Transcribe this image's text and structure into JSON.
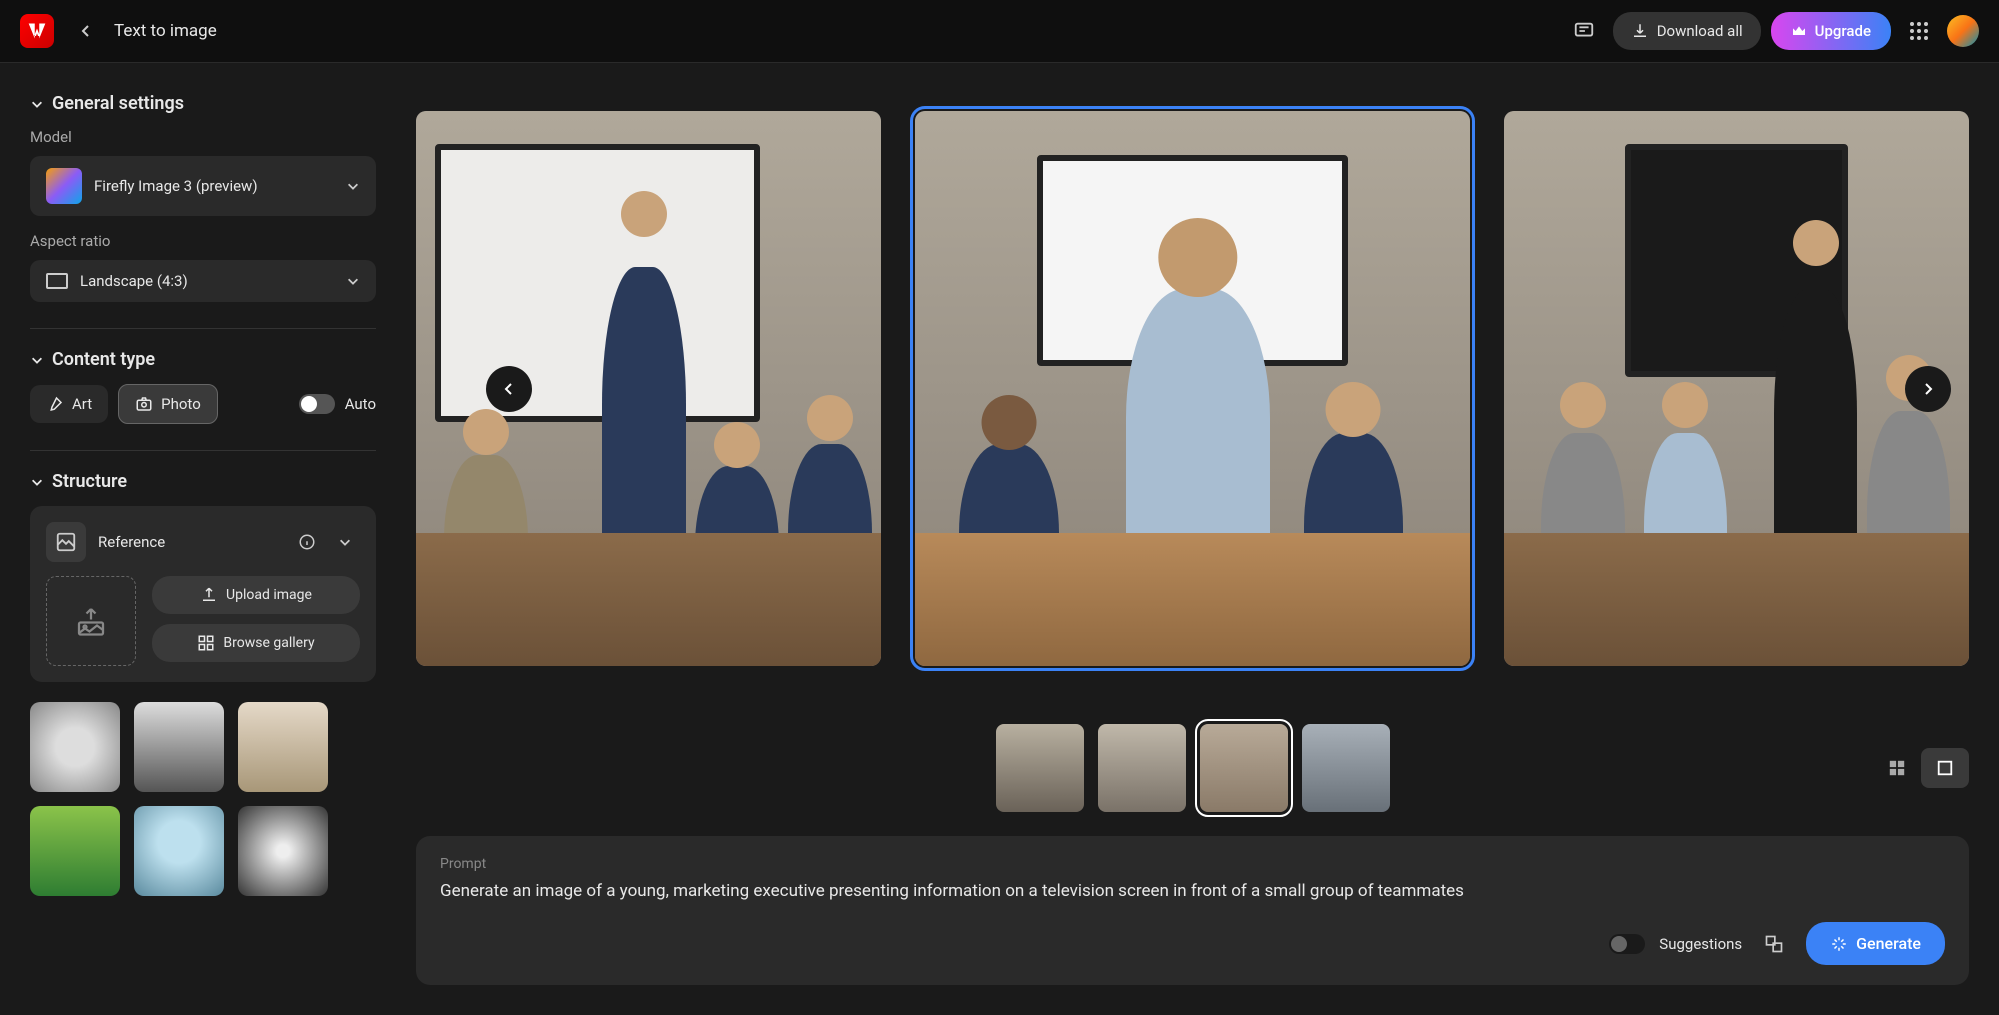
{
  "header": {
    "title": "Text to image",
    "download_label": "Download all",
    "upgrade_label": "Upgrade"
  },
  "sidebar": {
    "general": {
      "title": "General settings",
      "model_label": "Model",
      "model_value": "Firefly Image 3 (preview)",
      "aspect_label": "Aspect ratio",
      "aspect_value": "Landscape (4:3)"
    },
    "content_type": {
      "title": "Content type",
      "art_label": "Art",
      "photo_label": "Photo",
      "auto_label": "Auto"
    },
    "structure": {
      "title": "Structure",
      "reference_label": "Reference",
      "upload_label": "Upload image",
      "browse_label": "Browse gallery"
    }
  },
  "prompt": {
    "label": "Prompt",
    "text": "Generate an image of a young, marketing executive presenting information on a television screen in front of a small group of teammates",
    "suggestions_label": "Suggestions",
    "generate_label": "Generate"
  }
}
